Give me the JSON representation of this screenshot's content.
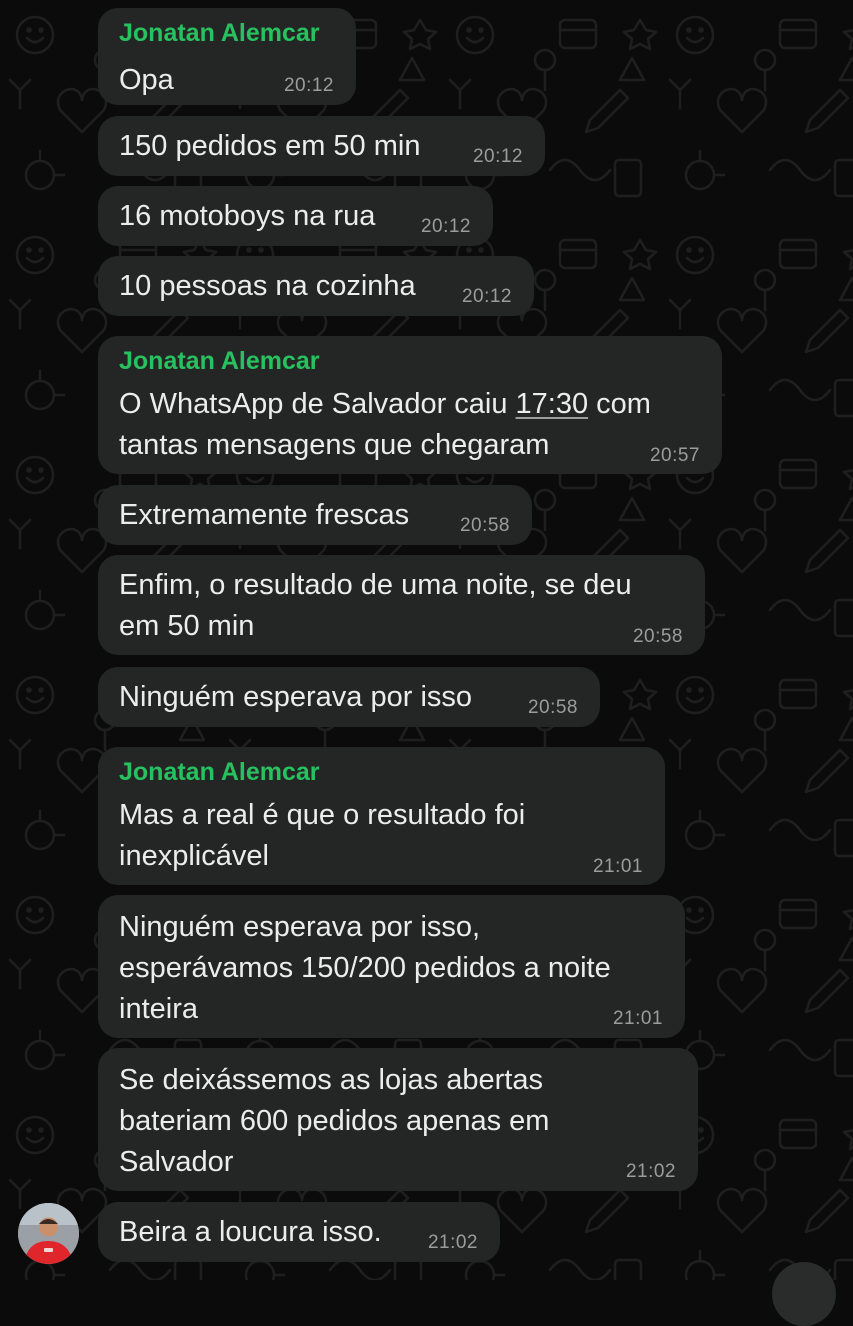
{
  "chat": {
    "sender_name": "Jonatan Alemcar",
    "messages": [
      {
        "text_lines": [
          "Opa"
        ],
        "time": "20:12",
        "show_sender": true
      },
      {
        "text_lines": [
          "150 pedidos em 50 min"
        ],
        "time": "20:12"
      },
      {
        "text_lines": [
          "16 motoboys na rua"
        ],
        "time": "20:12"
      },
      {
        "text_lines": [
          "10 pessoas na cozinha"
        ],
        "time": "20:12"
      },
      {
        "text_lines": [
          "O WhatsApp de Salvador caiu ",
          "tantas mensagens que chegaram"
        ],
        "linked_time": "17:30",
        "after_link": " com",
        "time": "20:57",
        "show_sender": true
      },
      {
        "text_lines": [
          "Extremamente frescas"
        ],
        "time": "20:58"
      },
      {
        "text_lines": [
          "Enfim, o resultado de uma noite, se deu",
          "em 50 min"
        ],
        "time": "20:58"
      },
      {
        "text_lines": [
          "Ninguém esperava por isso"
        ],
        "time": "20:58"
      },
      {
        "text_lines": [
          "Mas a real é que o resultado foi",
          "inexplicável"
        ],
        "time": "21:01",
        "show_sender": true
      },
      {
        "text_lines": [
          "Ninguém esperava por isso,",
          "esperávamos 150/200 pedidos a noite",
          "inteira"
        ],
        "time": "21:01"
      },
      {
        "text_lines": [
          "Se deixássemos as lojas abertas",
          "bateriam 600 pedidos apenas em",
          "Salvador"
        ],
        "time": "21:02"
      },
      {
        "text_lines": [
          "Beira a loucura isso."
        ],
        "time": "21:02"
      }
    ]
  },
  "colors": {
    "background": "#0b0b0b",
    "bubble": "#242626",
    "sender": "#27c25f",
    "text": "#ececec",
    "timestamp": "#9a9d9c"
  },
  "icons": {
    "avatar": "avatar-photo",
    "scroll_button": "scroll-down-icon"
  }
}
